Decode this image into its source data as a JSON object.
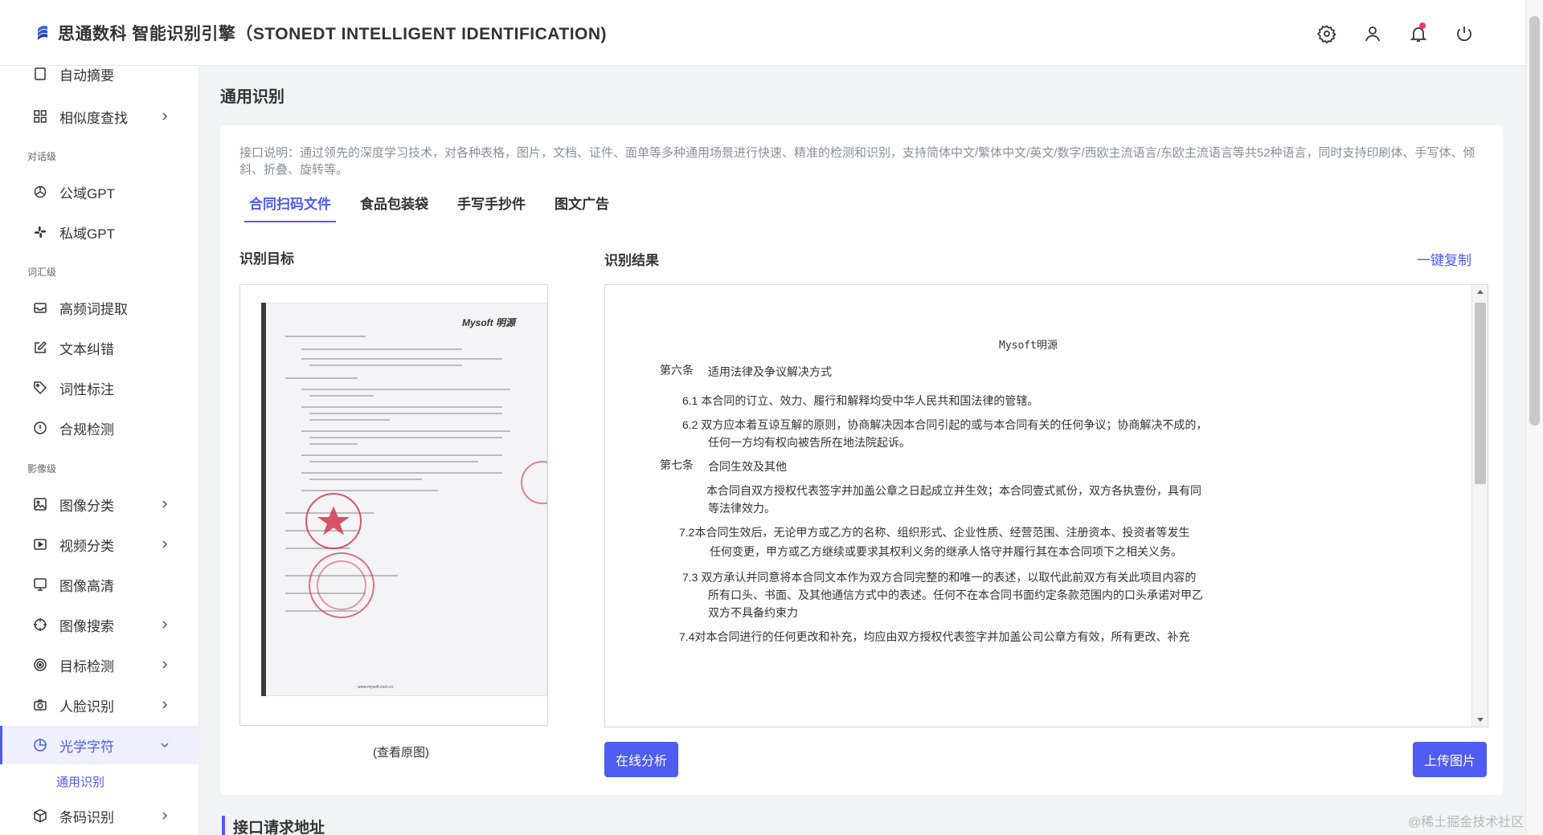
{
  "header": {
    "title": "思通数科 智能识别引擎（STONEDT INTELLIGENT IDENTIFICATION)",
    "icons": [
      "settings-icon",
      "user-icon",
      "bell-icon",
      "power-icon"
    ],
    "accent": "#4e5cf2"
  },
  "sidebar": {
    "partial_top": "自动摘要",
    "items_top": [
      {
        "label": "相似度查找",
        "icon": "grid-icon",
        "expandable": true
      }
    ],
    "groups": [
      {
        "title": "对话级",
        "items": [
          {
            "label": "公域GPT",
            "icon": "openai-icon"
          },
          {
            "label": "私域GPT",
            "icon": "slack-icon"
          }
        ]
      },
      {
        "title": "词汇级",
        "items": [
          {
            "label": "高频词提取",
            "icon": "inbox-icon"
          },
          {
            "label": "文本纠错",
            "icon": "edit-icon"
          },
          {
            "label": "词性标注",
            "icon": "tag-icon"
          },
          {
            "label": "合规检测",
            "icon": "alert-circle-icon"
          }
        ]
      },
      {
        "title": "影像级",
        "items": [
          {
            "label": "图像分类",
            "icon": "image-icon",
            "expandable": true
          },
          {
            "label": "视频分类",
            "icon": "video-icon",
            "expandable": true
          },
          {
            "label": "图像高清",
            "icon": "monitor-icon"
          },
          {
            "label": "图像搜索",
            "icon": "crosshair-icon",
            "expandable": true
          },
          {
            "label": "目标检测",
            "icon": "target-icon",
            "expandable": true
          },
          {
            "label": "人脸识别",
            "icon": "camera-icon",
            "expandable": true
          },
          {
            "label": "光学字符",
            "icon": "pie-icon",
            "expandable": true,
            "active": true
          },
          {
            "label": "条码识别",
            "icon": "box-icon",
            "expandable": true
          }
        ]
      }
    ],
    "sub_item": "通用识别"
  },
  "main": {
    "page_title": "通用识别",
    "description": "接口说明：通过领先的深度学习技术，对各种表格，图片，文档、证件、面单等多种通用场景进行快速、精准的检测和识别，支持简体中文/繁体中文/英文/数字/西欧主流语言/东欧主流语言等共52种语言，同时支持印刷体、手写体、倾斜、折叠、旋转等。",
    "tabs": [
      {
        "label": "合同扫码文件",
        "active": true
      },
      {
        "label": "食品包装袋"
      },
      {
        "label": "手写手抄件"
      },
      {
        "label": "图文广告"
      }
    ],
    "target_title": "识别目标",
    "result_title": "识别结果",
    "copy_label": "一键复制",
    "view_original": "(查看原图)",
    "analyze_button": "在线分析",
    "upload_button": "上传图片",
    "doc_logo": "Mysoft 明源",
    "doc_footer": "www.mysoft.com.cn",
    "result_lines": {
      "header": "Mysoft明源",
      "l1a": "第六条",
      "l1b": "适用法律及争议解决方式",
      "l2": "6.1  本合同的订立、效力、履行和解释均受中华人民共和国法律的管辖。",
      "l3": "6.2  双方应本着互谅互解的原则，协商解决因本合同引起的或与本合同有关的任何争议；协商解决不成的，",
      "l4": "任何一方均有权向被告所在地法院起诉。",
      "l5a": "第七条",
      "l5b": "合同生效及其他",
      "l6": "本合同自双方授权代表签字并加盖公章之日起成立并生效；本合同壹式贰份，双方各执壹份，具有同",
      "l7": "等法律效力。",
      "l8": "7.2本合同生效后，无论甲方或乙方的名称、组织形式、企业性质、经营范围、注册资本、投资者等发生",
      "l9": "任何变更，甲方或乙方继续或要求其权利义务的继承人恪守并履行其在本合同项下之相关义务。",
      "l10": "7.3  双方承认并同意将本合同文本作为双方合同完整的和唯一的表述，以取代此前双方有关此项目内容的",
      "l11": "所有口头、书面、及其他通信方式中的表述。任何不在本合同书面约定条款范围内的口头承诺对甲乙",
      "l12": "双方不具备约束力",
      "l13": "7.4对本合同进行的任何更改和补充，均应由双方授权代表签字并加盖公司公章方有效，所有更改、补充"
    },
    "api_title": "接口请求地址"
  },
  "watermark": "@稀土掘金技术社区"
}
